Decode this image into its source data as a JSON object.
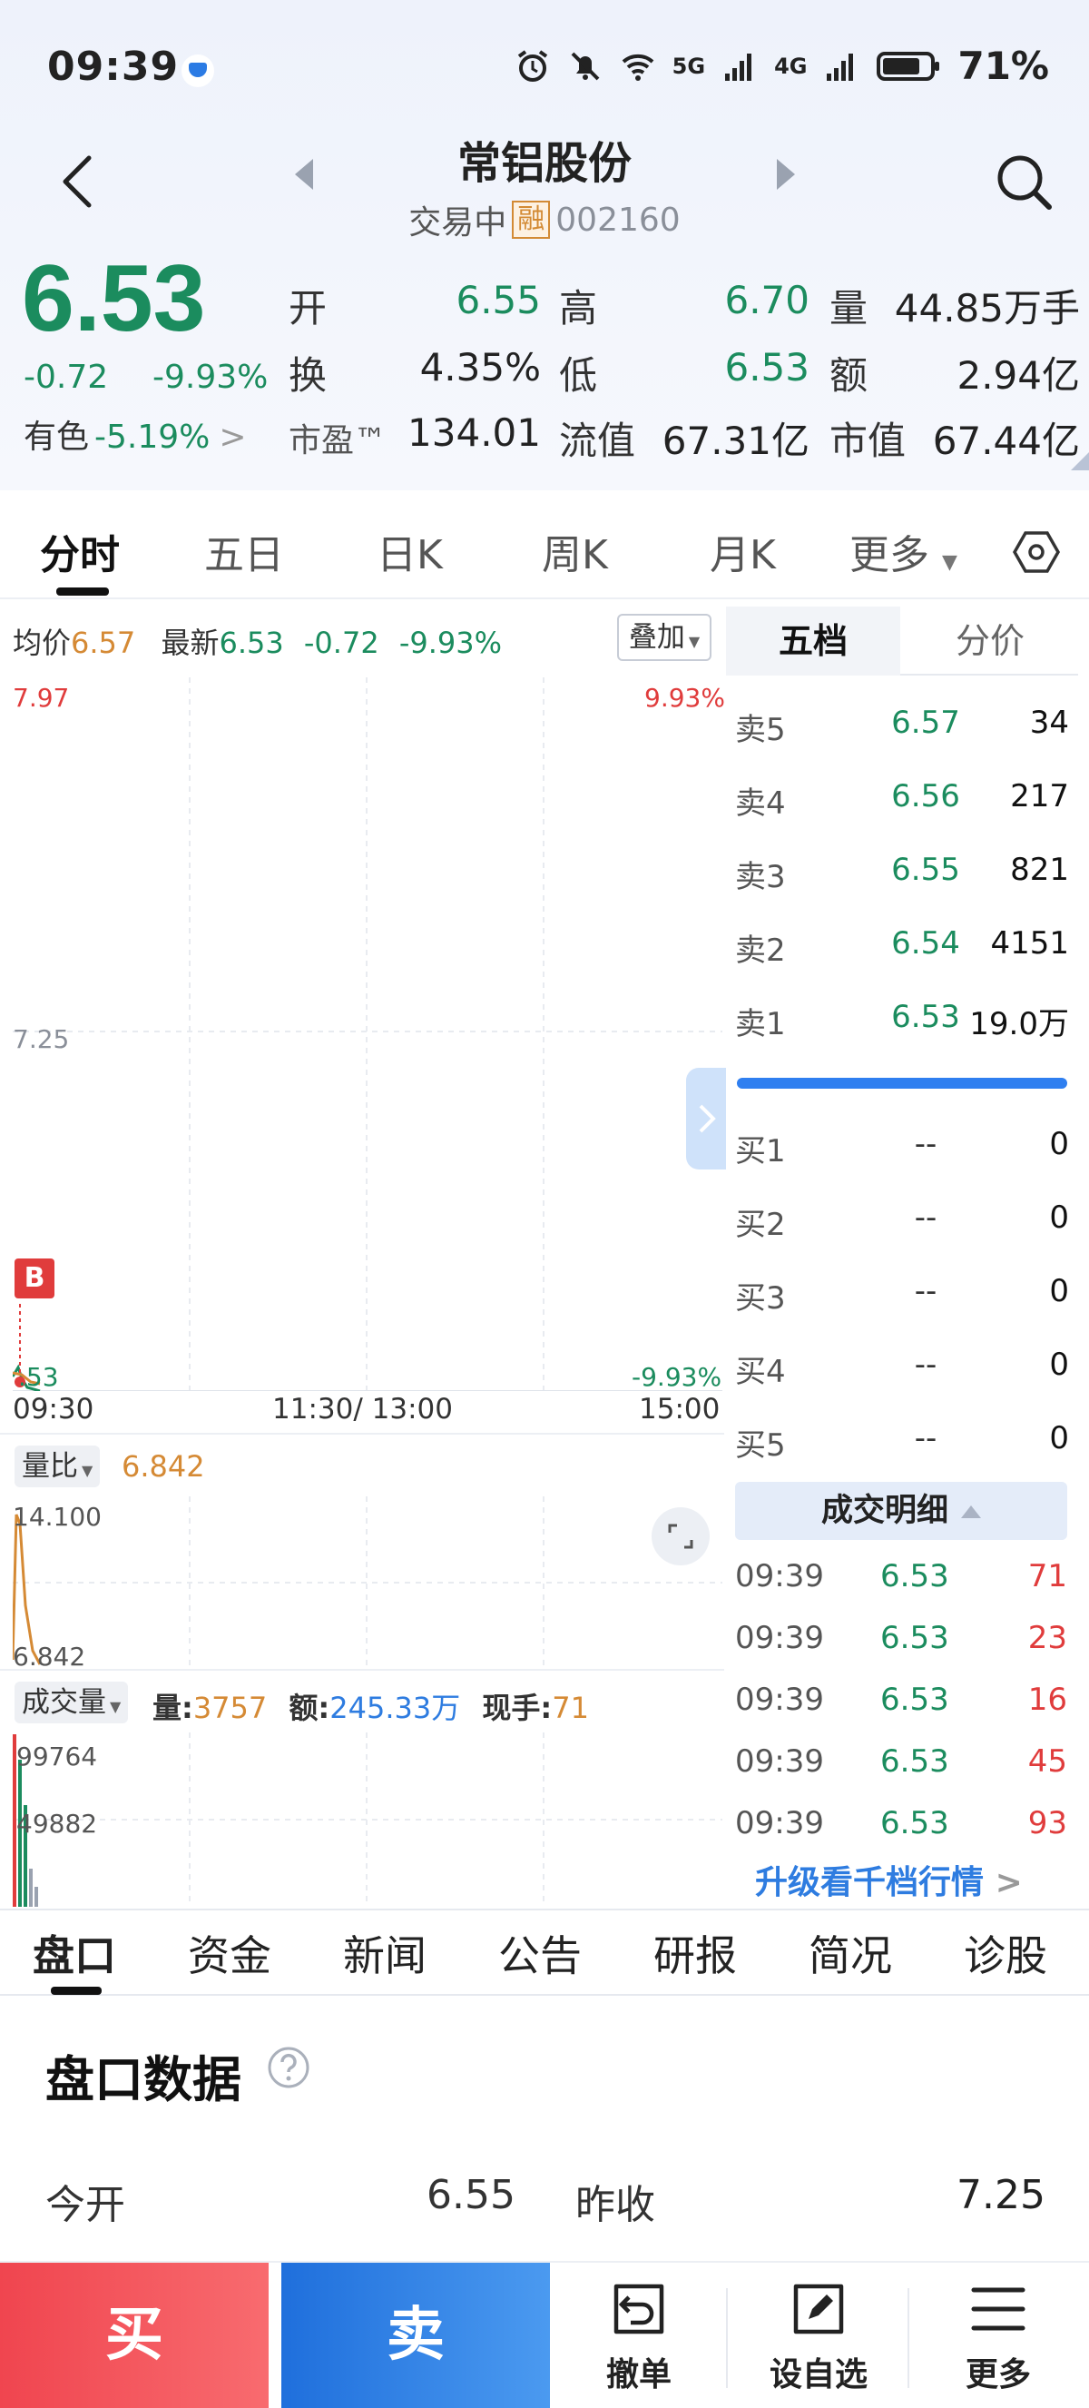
{
  "status_bar": {
    "time": "09:39",
    "battery": "71%",
    "net1": "5G",
    "net2": "4G"
  },
  "header": {
    "title": "常铝股份",
    "trading_status": "交易中",
    "margin_badge": "融",
    "code": "002160"
  },
  "quote": {
    "price": "6.53",
    "change": "-0.72",
    "change_pct": "-9.93%",
    "sector_name": "有色",
    "sector_pct": "-5.19%",
    "sector_arrow": ">",
    "rows": [
      [
        {
          "l": "开",
          "v": "6.55",
          "c": "green"
        },
        {
          "l": "高",
          "v": "6.70",
          "c": "green"
        },
        {
          "l": "量",
          "v": "44.85万手",
          "c": "dark"
        }
      ],
      [
        {
          "l": "换",
          "v": "4.35%",
          "c": "dark"
        },
        {
          "l": "低",
          "v": "6.53",
          "c": "green"
        },
        {
          "l": "额",
          "v": "2.94亿",
          "c": "dark"
        }
      ],
      [
        {
          "l": "市盈™",
          "v": "134.01",
          "c": "dark"
        },
        {
          "l": "流值",
          "v": "67.31亿",
          "c": "dark"
        },
        {
          "l": "市值",
          "v": "67.44亿",
          "c": "dark"
        }
      ]
    ]
  },
  "chart_tabs": {
    "items": [
      "分时",
      "五日",
      "日K",
      "周K",
      "月K",
      "更多"
    ],
    "active": "分时"
  },
  "intraday": {
    "avg_label": "均价",
    "avg_value": "6.57",
    "latest_label": "最新",
    "latest_value": "6.53",
    "latest_change": "-0.72",
    "latest_pct": "-9.93%",
    "overlay_label": "叠加",
    "y_top": "7.97",
    "y_mid": "7.25",
    "y_bottom": ".53",
    "pct_top": "9.93%",
    "pct_bottom": "-9.93%",
    "b_marker": "B",
    "times": [
      "09:30",
      "11:30/ 13:00",
      "15:00"
    ]
  },
  "volume_ratio": {
    "label": "量比",
    "value": "6.842",
    "y_top": "14.100",
    "y_bottom": "6.842"
  },
  "volume": {
    "label": "成交量",
    "qty_label": "量:",
    "qty_value": "3757",
    "amt_label": "额:",
    "amt_value": "245.33万",
    "hand_label": "现手:",
    "hand_value": "71",
    "y_top": "99764",
    "y_mid": "49882"
  },
  "order_book": {
    "tabs": [
      "五档",
      "分价"
    ],
    "asks": [
      {
        "label": "卖5",
        "price": "6.57",
        "vol": "34"
      },
      {
        "label": "卖4",
        "price": "6.56",
        "vol": "217"
      },
      {
        "label": "卖3",
        "price": "6.55",
        "vol": "821"
      },
      {
        "label": "卖2",
        "price": "6.54",
        "vol": "4151"
      },
      {
        "label": "卖1",
        "price": "6.53",
        "vol": "19.0万"
      }
    ],
    "bids": [
      {
        "label": "买1",
        "price": "--",
        "vol": "0"
      },
      {
        "label": "买2",
        "price": "--",
        "vol": "0"
      },
      {
        "label": "买3",
        "price": "--",
        "vol": "0"
      },
      {
        "label": "买4",
        "price": "--",
        "vol": "0"
      },
      {
        "label": "买5",
        "price": "--",
        "vol": "0"
      }
    ]
  },
  "deals": {
    "title": "成交明细",
    "rows": [
      {
        "t": "09:39",
        "p": "6.53",
        "v": "71"
      },
      {
        "t": "09:39",
        "p": "6.53",
        "v": "23"
      },
      {
        "t": "09:39",
        "p": "6.53",
        "v": "16"
      },
      {
        "t": "09:39",
        "p": "6.53",
        "v": "45"
      },
      {
        "t": "09:39",
        "p": "6.53",
        "v": "93"
      }
    ],
    "upgrade": "升级看千档行情"
  },
  "bottom_tabs": {
    "items": [
      "盘口",
      "资金",
      "新闻",
      "公告",
      "研报",
      "简况",
      "诊股"
    ],
    "active": "盘口"
  },
  "panel": {
    "title": "盘口数据",
    "open_label": "今开",
    "open_value": "6.55",
    "prev_label": "昨收",
    "prev_value": "7.25"
  },
  "actions": {
    "buy": "买",
    "sell": "卖",
    "cancel": "撤单",
    "watch": "设自选",
    "more": "更多"
  },
  "colors": {
    "down_green": "#1b8c5e",
    "up_red": "#e03c3c",
    "accent_blue": "#2f7ff0",
    "avg_orange": "#d58a35"
  }
}
